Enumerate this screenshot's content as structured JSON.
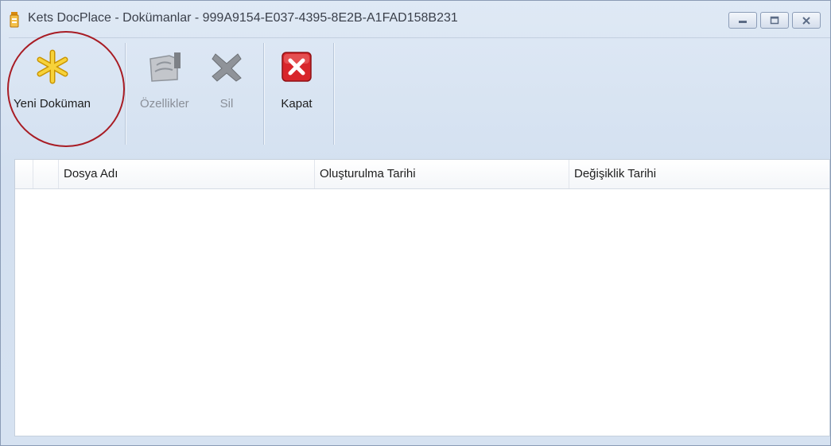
{
  "window": {
    "title": "Kets DocPlace - Dokümanlar - 999A9154-E037-4395-8E2B-A1FAD158B231",
    "minimize_icon": "minimize-icon",
    "maximize_icon": "maximize-icon",
    "close_icon": "close-icon"
  },
  "toolbar": {
    "new_document": {
      "label": "Yeni Doküman",
      "icon": "asterisk-icon",
      "enabled": true
    },
    "properties": {
      "label": "Özellikler",
      "icon": "document-hand-icon",
      "enabled": false
    },
    "delete": {
      "label": "Sil",
      "icon": "x-icon",
      "enabled": false
    },
    "close": {
      "label": "Kapat",
      "icon": "close-red-icon",
      "enabled": true
    }
  },
  "grid": {
    "columns": [
      "",
      "Dosya Adı",
      "Oluşturulma Tarihi",
      "Değişiklik Tarihi"
    ],
    "rows": []
  },
  "colors": {
    "highlight_ring": "#a81c24",
    "ribbon_bg": "#d6e2f1",
    "close_button_red": "#d8262b",
    "asterisk_yellow": "#f7c41a"
  }
}
